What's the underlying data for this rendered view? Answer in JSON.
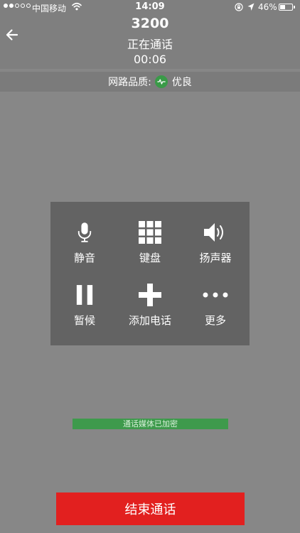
{
  "status_bar": {
    "carrier": "中国移动",
    "time": "14:09",
    "battery": "46%",
    "battery_level": 0.46,
    "signal_bars": 2,
    "signal_total": 5
  },
  "call": {
    "number": "3200",
    "status": "正在通话",
    "duration": "00:06"
  },
  "quality": {
    "label": "网路品质:",
    "value": "优良",
    "color": "#3a9a48"
  },
  "controls": {
    "mute": "静音",
    "keypad": "键盘",
    "speaker": "扬声器",
    "hold": "暂候",
    "add_call": "添加电话",
    "more": "更多"
  },
  "encryption": "通话媒体已加密",
  "end_call": "结束通话",
  "colors": {
    "end_call": "#e2201f",
    "encryption": "#3e9a4c"
  }
}
